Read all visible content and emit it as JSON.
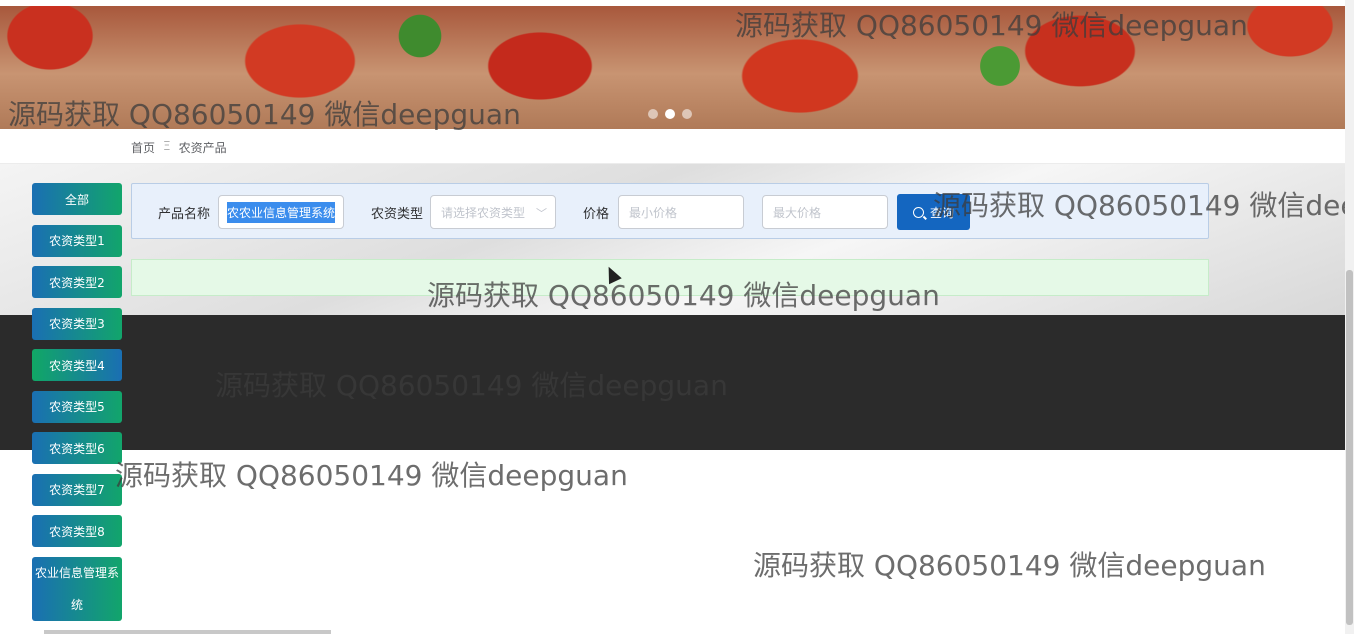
{
  "banner": {
    "dots": 3,
    "active_dot": 1
  },
  "breadcrumb": {
    "home": "首页",
    "separator": "Ξ",
    "current": "农资产品"
  },
  "sidebar": {
    "items": [
      {
        "label": "全部"
      },
      {
        "label": "农资类型1"
      },
      {
        "label": "农资类型2"
      },
      {
        "label": "农资类型3"
      },
      {
        "label": "农资类型4"
      },
      {
        "label": "农资类型5"
      },
      {
        "label": "农资类型6"
      },
      {
        "label": "农资类型7"
      },
      {
        "label": "农资类型8"
      },
      {
        "label": "农业信息管理系统"
      }
    ]
  },
  "search": {
    "name_label": "产品名称",
    "name_value": "农农业信息管理系统",
    "type_label": "农资类型",
    "type_placeholder": "请选择农资类型",
    "price_label": "价格",
    "min_placeholder": "最小价格",
    "max_placeholder": "最大价格",
    "button_label": "查询"
  },
  "watermark": "源码获取 QQ86050149 微信deepguan"
}
